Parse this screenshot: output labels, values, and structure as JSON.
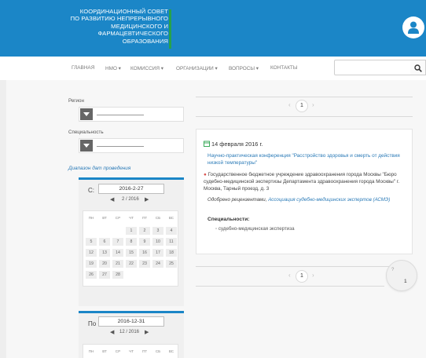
{
  "header": {
    "brand_lines": [
      "КООРДИНАЦИОННЫЙ СОВЕТ",
      "ПО РАЗВИТИЮ НЕПРЕРЫВНОГО",
      "МЕДИЦИНСКОГО И",
      "ФАРМАЦЕВТИЧЕСКОГО",
      "ОБРАЗОВАНИЯ"
    ],
    "brand_color": "#1b86c7",
    "accent_bar_color": "#27a24a",
    "avatar_icon": "user-icon"
  },
  "nav": {
    "items": [
      {
        "label": "ГЛАВНАЯ"
      },
      {
        "label": "НМО ▾"
      },
      {
        "label": "КОМИССИЯ ▾"
      },
      {
        "label": "ОРГАНИЗАЦИИ ▾"
      },
      {
        "label": "ВОПРОСЫ ▾"
      },
      {
        "label": "КОНТАКТЫ"
      }
    ],
    "search": {
      "placeholder": "",
      "value": "",
      "icon": "search-icon"
    }
  },
  "filters": {
    "region_label": "Регион",
    "specialty_label": "Специальность",
    "range_link": "Диапазон дат проведения",
    "from": {
      "label": "С:",
      "date_value": "2016-2-27",
      "month_nav": "2 / 2016",
      "weekdays": [
        "ПН",
        "ВТ",
        "СР",
        "ЧТ",
        "ПТ",
        "СБ",
        "ВС"
      ],
      "days": [
        "",
        "",
        "",
        "1",
        "2",
        "3",
        "4",
        "5",
        "6",
        "7",
        "8",
        "9",
        "10",
        "11",
        "12",
        "13",
        "14",
        "15",
        "16",
        "17",
        "18",
        "19",
        "20",
        "21",
        "22",
        "23",
        "24",
        "25",
        "26",
        "27",
        "28"
      ]
    },
    "to": {
      "label": "По",
      "date_value": "2016-12-31",
      "month_nav": "12 / 2016",
      "weekdays": [
        "ПН",
        "ВТ",
        "СР",
        "ЧТ",
        "ПТ",
        "СБ",
        "ВС"
      ]
    }
  },
  "pager": {
    "current": "1",
    "prev_icon": "chevron-left-icon",
    "next_icon": "chevron-right-icon"
  },
  "event": {
    "date": "14 февраля 2016 г.",
    "date_icon": "calendar-icon",
    "title": "Научно-практическая конференция \"Расстройство здоровья и смерть от действия низкой температуры\"",
    "place_icon": "map-pin-icon",
    "place": "Государственное бюджетное учреждение здравоохранения города Москвы \"Бюро судебно-медицинской экспертизы Департамента здравоохранения города Москвы\" г. Москва, Тарный проезд, д. 3",
    "org_prefix": "Одобрено рецензентами,",
    "org_link": "Ассоциация судебно-медицинских экспертов (АСМЭ)",
    "specialties_heading": "Специальности:",
    "specialties": [
      "судебно-медицинская экспертиза"
    ]
  },
  "float_badge": {
    "top": "?",
    "count": "1"
  }
}
